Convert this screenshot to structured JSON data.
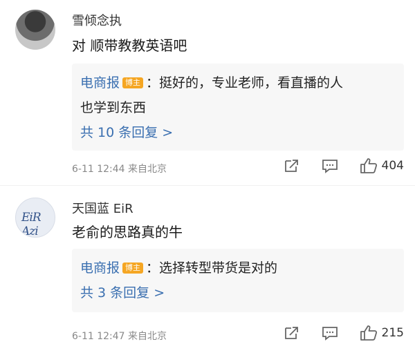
{
  "comments": [
    {
      "username": "雪倾念执",
      "content": "对 顺带教教英语吧",
      "reply": {
        "user": "电商报",
        "badge": "博主",
        "text_line1": "：挺好的，专业老师，看直播的人",
        "text_line2": "也学到东西",
        "more": "共 10 条回复 >"
      },
      "meta": "6-11 12:44  来自北京",
      "likes": "404"
    },
    {
      "username": "天国蓝 EiR",
      "avatar_text": "EiR Azi",
      "content": "老俞的思路真的牛",
      "reply": {
        "user": "电商报",
        "badge": "博主",
        "text_line1": "：选择转型带货是对的",
        "more": "共 3 条回复 >"
      },
      "meta": "6-11 12:47  来自北京",
      "likes": "215"
    }
  ],
  "icons": {
    "share": "share-icon",
    "comment": "comment-icon",
    "like": "like-icon"
  },
  "colors": {
    "link": "#3a6fb0",
    "badge": "#f5a623",
    "reply_bg": "#f7f7f7"
  }
}
